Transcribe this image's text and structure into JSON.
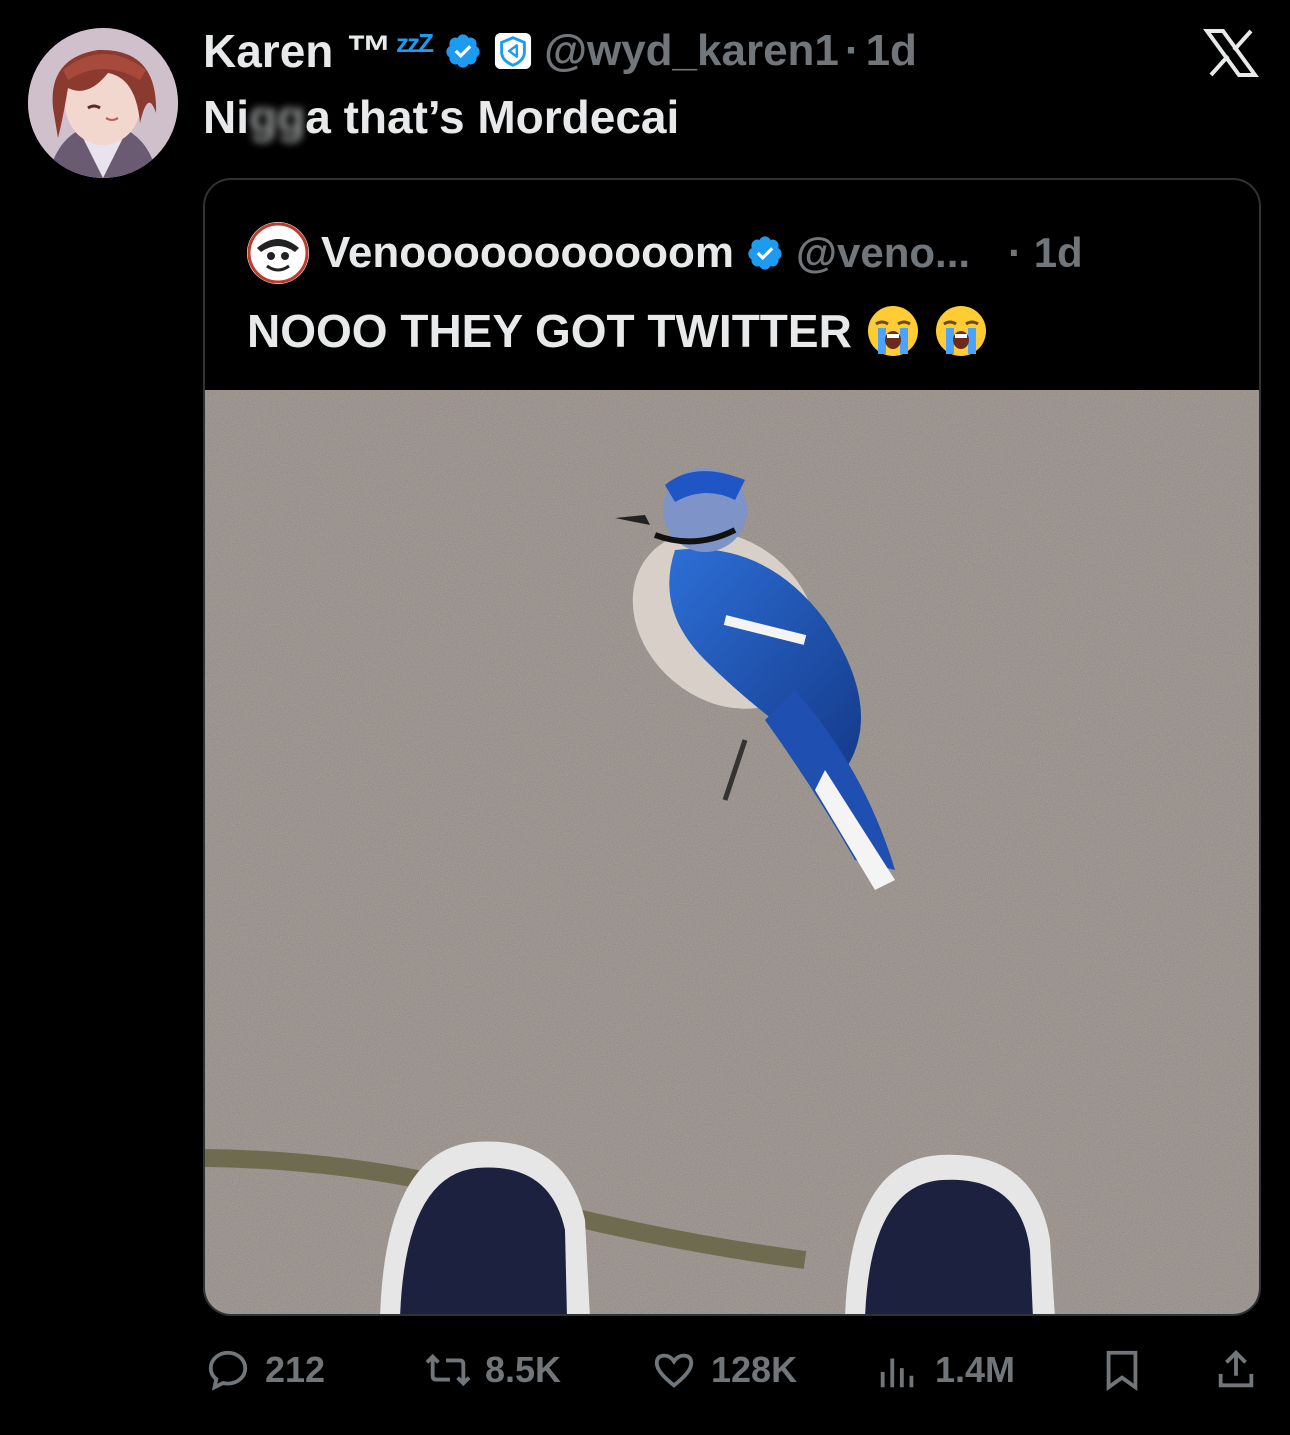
{
  "tweet": {
    "author": {
      "display_name": "Karen ™",
      "name_decoration": "zzZ",
      "handle": "@wyd_karen1",
      "time": "1d",
      "separator": "·"
    },
    "text_prefix": "Ni",
    "text_censored": "gg",
    "text_rest": "a that’s Mordecai"
  },
  "quote": {
    "display_name": "Venooooooooooom",
    "handle": "@veno...",
    "time": "· 1d",
    "text": "NOOO THEY GOT TWITTER",
    "emoji": [
      "loudly-crying-face-emoji",
      "loudly-crying-face-emoji"
    ]
  },
  "actions": {
    "replies": "212",
    "reposts": "8.5K",
    "likes": "128K",
    "views": "1.4M"
  },
  "colors": {
    "background": "#000000",
    "text_primary": "#e7e9ea",
    "text_secondary": "#71767b",
    "verified_blue": "#1d9bf0",
    "card_border": "#2f3336"
  }
}
